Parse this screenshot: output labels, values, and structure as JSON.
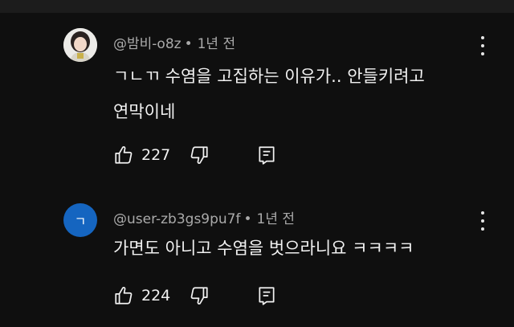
{
  "comments": [
    {
      "author": "@밤비-o8z",
      "separator": "•",
      "time": "1년 전",
      "lines": [
        "ㄱㄴㄲ 수염을 고집하는 이유가.. 안들키려고",
        "연막이네"
      ],
      "likes": "227",
      "avatar_type": "photo"
    },
    {
      "author": "@user-zb3gs9pu7f",
      "separator": "•",
      "time": "1년 전",
      "lines": [
        "가면도 아니고 수염을 벗으라니요 ㅋㅋㅋㅋ"
      ],
      "likes": "224",
      "avatar_letter": "ㄱ",
      "avatar_color": "#1565c0"
    }
  ],
  "icons": [
    "thumb-up-icon",
    "thumb-down-icon",
    "reply-icon",
    "more-vert-icon"
  ],
  "colors": {
    "background": "#0f0f0f",
    "text": "#f1f1f1",
    "meta": "#aaaaaa",
    "avatar_blue": "#1565c0"
  }
}
